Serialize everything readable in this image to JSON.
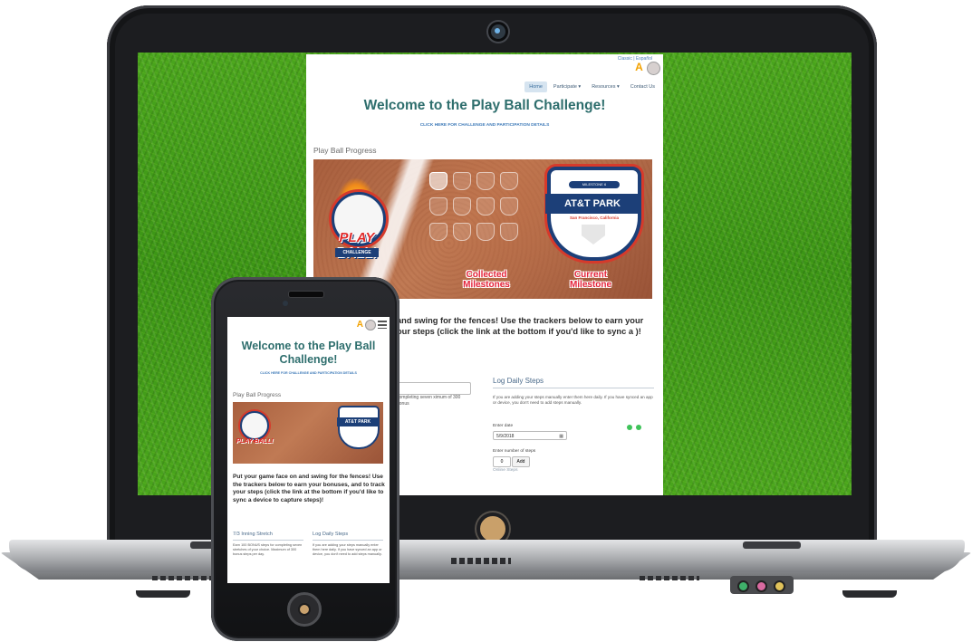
{
  "desktop": {
    "top_links": "Classic | Español",
    "nav": [
      "Home",
      "Participate ▾",
      "Resources ▾",
      "Contact Us"
    ],
    "title": "Welcome to the Play Ball Challenge!",
    "details_link": "CLICK HERE FOR CHALLENGE AND PARTICIPATION DETAILS",
    "progress_title": "Play Ball Progress",
    "banner": {
      "logo_text": "PLAY BALL!",
      "logo_sub": "CHALLENGE",
      "park_top": "MILESTONE 6",
      "park_name": "AT&T PARK",
      "park_location": "San Francisco, California",
      "caption_collected": "Collected Milestones",
      "caption_current": "Current Milestone"
    },
    "intro": "and swing for the fences! Use the trackers below to earn your our steps (click the link at the bottom if you'd like to sync a )!",
    "tracker_text": "completing seven ximum of 300 bonus",
    "log": {
      "title": "Log Daily Steps",
      "help": "If you are adding your steps manually enter them here daily. If you have synced an app or device, you don't need to add steps manually.",
      "date_label": "Enter date",
      "date_value": "5/9/2018",
      "steps_label": "Enter number of steps",
      "steps_value": "0",
      "add_label": "Add",
      "footer_link": "Online Steps"
    }
  },
  "mobile": {
    "title": "Welcome to the Play Ball Challenge!",
    "details_link": "CLICK HERE FOR CHALLENGE AND PARTICIPATION DETAILS",
    "progress_title": "Play Ball Progress",
    "intro": "Put your game face on and swing for the fences! Use the trackers below to earn your bonuses, and to track your steps (click the link at the bottom if you'd like to sync a device to capture steps)!",
    "col1_title": "7/3 Inning Stretch",
    "col1_text": "Earn 100 BONUS steps for completing seven stretches of your choice. Maximum of 300 bonus steps per day.",
    "col2_title": "Log Daily Steps",
    "col2_text": "If you are adding your steps manually enter them here daily. If you have synced an app or device, you don't need to add steps manually."
  },
  "colors": {
    "title_teal": "#2e6e6d",
    "link_blue": "#3e7ab8",
    "accent_red": "#e5223a",
    "navy": "#1c3f78",
    "grass_green": "#3b9416"
  }
}
